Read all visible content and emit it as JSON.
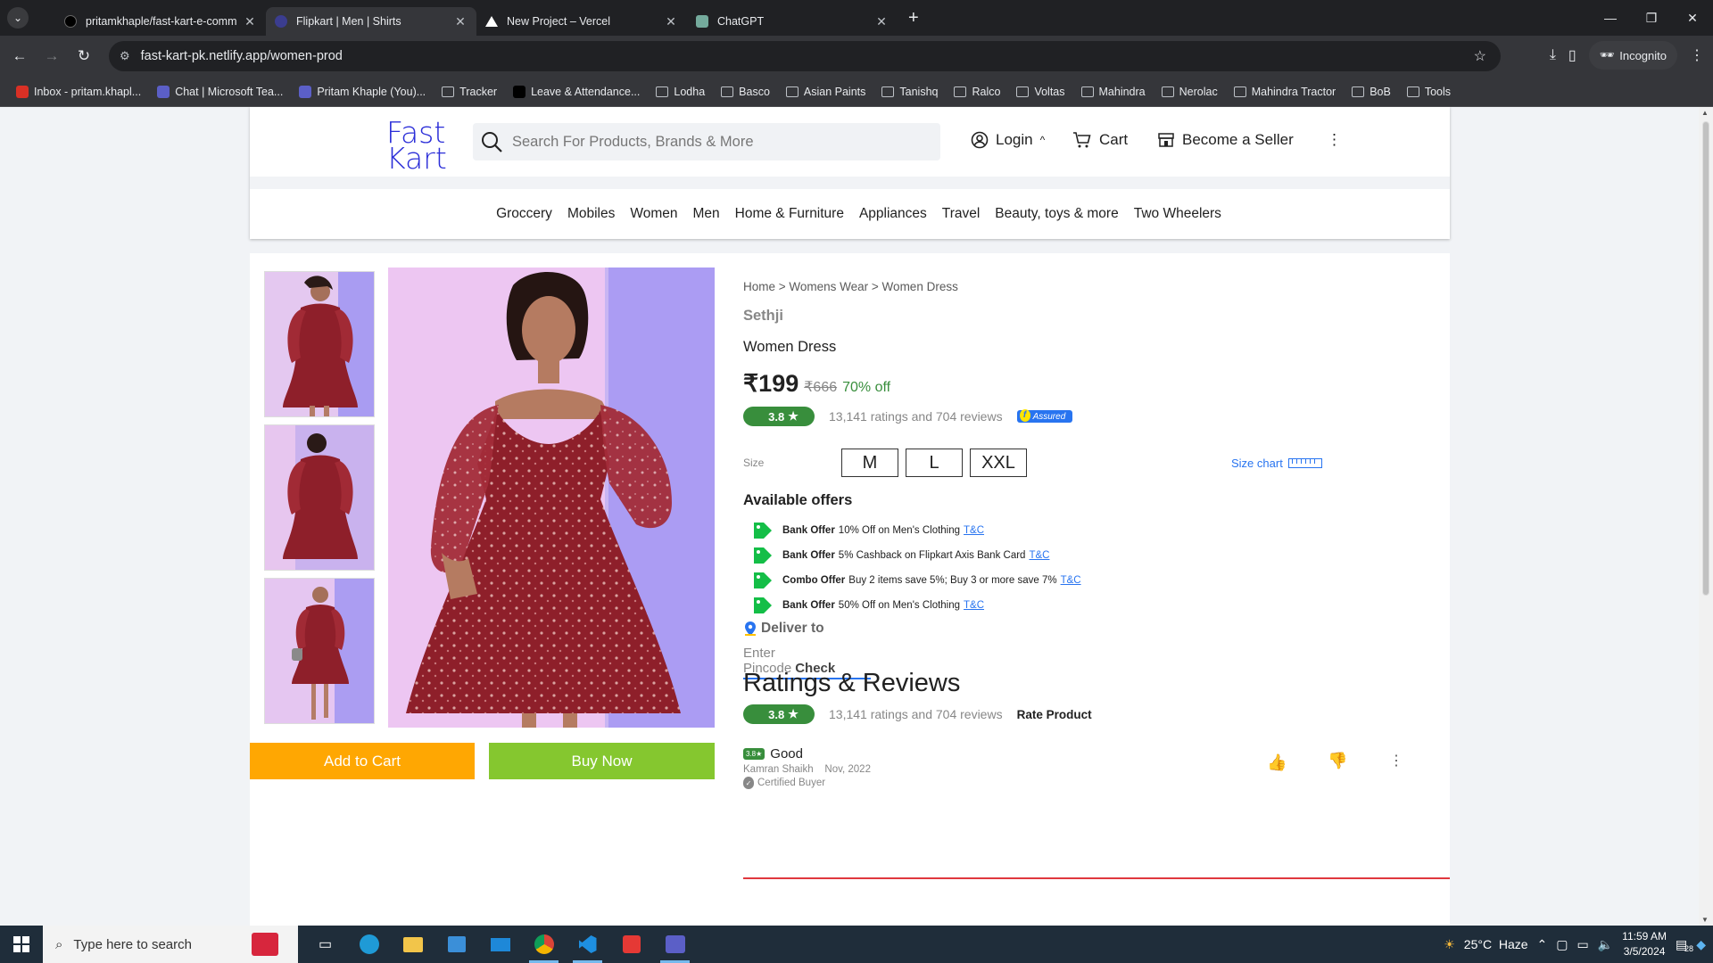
{
  "browser": {
    "tabs": [
      {
        "title": "pritamkhaple/fast-kart-e-comm",
        "active": false,
        "icon": "github-icon"
      },
      {
        "title": "Flipkart | Men | Shirts",
        "active": true,
        "icon": "page-icon"
      },
      {
        "title": "New Project – Vercel",
        "active": false,
        "icon": "vercel-icon"
      },
      {
        "title": "ChatGPT",
        "active": false,
        "icon": "chatgpt-icon"
      }
    ],
    "url": "fast-kart-pk.netlify.app/women-prod",
    "incognito_label": "Incognito",
    "bookmarks": [
      {
        "label": "Inbox - pritam.khapl...",
        "icon": "gmail-icon"
      },
      {
        "label": "Chat | Microsoft Tea...",
        "icon": "teams-icon"
      },
      {
        "label": "Pritam Khaple (You)...",
        "icon": "teams-icon"
      },
      {
        "label": "Tracker",
        "icon": "folder-icon"
      },
      {
        "label": "Leave & Attendance...",
        "icon": "x-icon"
      },
      {
        "label": "Lodha",
        "icon": "folder-icon"
      },
      {
        "label": "Basco",
        "icon": "folder-icon"
      },
      {
        "label": "Asian Paints",
        "icon": "folder-icon"
      },
      {
        "label": "Tanishq",
        "icon": "folder-icon"
      },
      {
        "label": "Ralco",
        "icon": "folder-icon"
      },
      {
        "label": "Voltas",
        "icon": "folder-icon"
      },
      {
        "label": "Mahindra",
        "icon": "folder-icon"
      },
      {
        "label": "Nerolac",
        "icon": "folder-icon"
      },
      {
        "label": "Mahindra Tractor",
        "icon": "folder-icon"
      },
      {
        "label": "BoB",
        "icon": "folder-icon"
      },
      {
        "label": "Tools",
        "icon": "folder-icon"
      }
    ]
  },
  "header": {
    "logo_line1": "Fast",
    "logo_line2": "Kart",
    "search_placeholder": "Search For Products, Brands & More",
    "login_label": "Login",
    "login_caret": "^",
    "cart_label": "Cart",
    "seller_label": "Become a Seller",
    "more_label": "⋮"
  },
  "categories": [
    "Groccery",
    "Mobiles",
    "Women",
    "Men",
    "Home & Furniture",
    "Appliances",
    "Travel",
    "Beauty, toys & more",
    "Two Wheelers"
  ],
  "product": {
    "breadcrumb": "Home > Womens Wear > Women Dress",
    "brand": "Sethji",
    "name": "Women Dress",
    "price": "₹199",
    "mrp": "₹666",
    "discount": "70% off",
    "rating": "3.8",
    "ratings_text": "13,141 ratings and 704 reviews",
    "assured_label": "Assured",
    "size_label": "Size",
    "sizes": [
      "M",
      "L",
      "XXL"
    ],
    "size_chart_label": "Size chart",
    "add_to_cart_label": "Add to Cart",
    "buy_now_label": "Buy Now",
    "dress_color": "#8e1f2a",
    "accent_green": "#388e3c"
  },
  "offers": {
    "title": "Available offers",
    "items": [
      {
        "type": "Bank Offer",
        "text": "10% Off on Men's Clothing",
        "link": "T&C"
      },
      {
        "type": "Bank Offer",
        "text": "5% Cashback on Flipkart Axis Bank Card",
        "link": "T&C"
      },
      {
        "type": "Combo Offer",
        "text": "Buy 2 items save 5%; Buy 3 or more save 7%",
        "link": "T&C"
      },
      {
        "type": "Bank Offer",
        "text": "50% Off on Men's Clothing",
        "link": "T&C"
      }
    ]
  },
  "delivery": {
    "title": "Deliver to",
    "placeholder": "Enter Pincode",
    "check_label": "Check"
  },
  "reviews": {
    "title": "Ratings & Reviews",
    "rating": "3.8",
    "ratings_text": "13,141 ratings and 704 reviews",
    "rate_label": "Rate Product",
    "first": {
      "rating": "3.8★",
      "title": "Good",
      "author": "Kamran Shaikh",
      "date": "Nov, 2022",
      "certified": "Certified Buyer"
    }
  },
  "taskbar": {
    "search_placeholder": "Type here to search",
    "weather": "25°C  Haze",
    "time": "11:59 AM",
    "date": "3/5/2024",
    "notifications": "28"
  }
}
